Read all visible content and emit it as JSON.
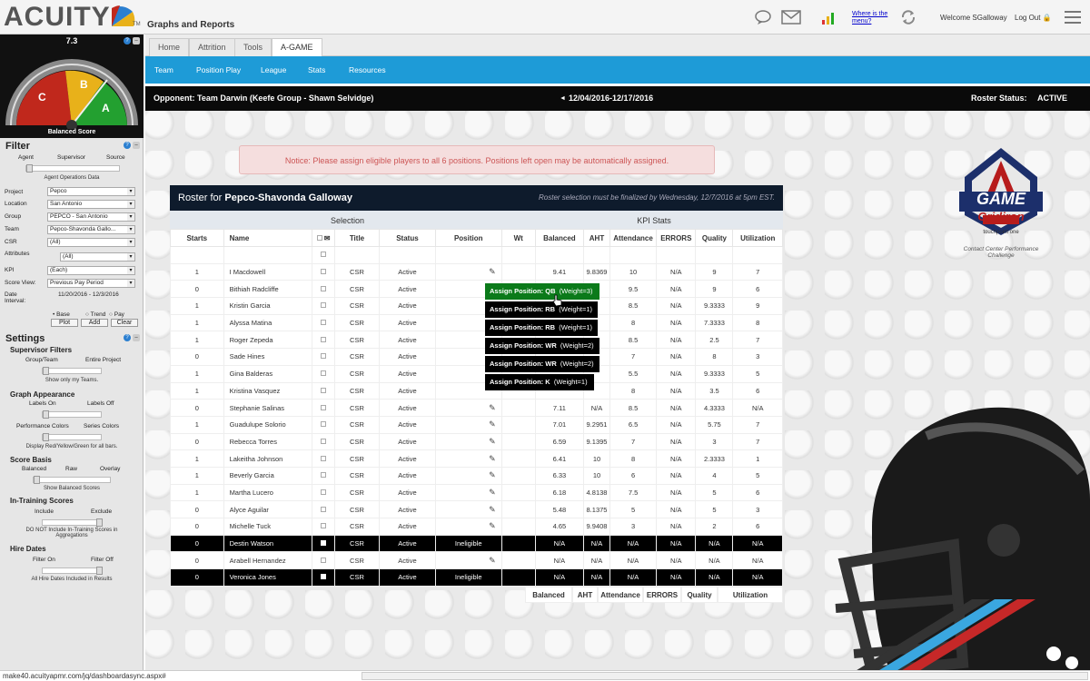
{
  "app": {
    "logo": "ACUITY",
    "logo_tm": "TM",
    "title": "Graphs and Reports",
    "where_link": "Where is the menu?",
    "welcome": "Welcome SGalloway",
    "logout": "Log Out"
  },
  "gauge": {
    "value": "7.3",
    "label": "Balanced Score",
    "zones": [
      "C",
      "B",
      "A"
    ]
  },
  "filter": {
    "title": "Filter",
    "scope_labels": [
      "Agent",
      "Supervisor",
      "Source"
    ],
    "scope_caption": "Agent Operations Data",
    "fields": [
      {
        "label": "Project",
        "value": "Pepco"
      },
      {
        "label": "Location",
        "value": "San Antonio"
      },
      {
        "label": "Group",
        "value": "PEPCO - San Antonio"
      },
      {
        "label": "Team",
        "value": "Pepco-Shavonda Gallo..."
      },
      {
        "label": "CSR",
        "value": "(All)"
      },
      {
        "label": "Attributes",
        "value": "(All)"
      },
      {
        "label": "KPI",
        "value": "(Each)"
      },
      {
        "label": "Score View:",
        "value": "Previous Pay Period"
      }
    ],
    "date_label": "Date Interval:",
    "date_value": "11/20/2016 - 12/3/2016",
    "radios": [
      "Base",
      "Trend",
      "Pay"
    ],
    "buttons": [
      "Plot",
      "Add",
      "Clear"
    ]
  },
  "settings": {
    "title": "Settings",
    "groups": [
      {
        "title": "Supervisor Filters",
        "left": "Group/Team",
        "right": "Entire Project",
        "caption": "Show only my Teams."
      },
      {
        "title": "Graph Appearance",
        "left": "Labels On",
        "right": "Labels Off",
        "caption": ""
      },
      {
        "title": "",
        "left": "Performance Colors",
        "right": "Series Colors",
        "caption": "Display Red/Yellow/Green for all bars."
      },
      {
        "title": "Score Basis",
        "left": "Balanced",
        "mid": "Raw",
        "right": "Overlay",
        "caption": "Show Balanced Scores"
      },
      {
        "title": "In-Training Scores",
        "left": "Include",
        "right": "Exclude",
        "caption": "DO NOT Include In-Training Scores in Aggregations"
      },
      {
        "title": "Hire Dates",
        "left": "Filter On",
        "right": "Filter Off",
        "caption": "All Hire Dates Included in Results"
      }
    ]
  },
  "tabs": [
    "Home",
    "Attrition",
    "Tools",
    "A-GAME"
  ],
  "subnav": [
    "Team",
    "Position Play",
    "League",
    "Stats",
    "Resources"
  ],
  "opponent": {
    "text": "Opponent:  Team Darwin (Keefe Group - Shawn Selvidge)",
    "dates": "12/04/2016-12/17/2016",
    "status_label": "Roster Status:",
    "status_value": "ACTIVE"
  },
  "notice": "Notice: Please assign eligible players to all 6 positions. Positions left open may be automatically assigned.",
  "logo_badge": {
    "line1": "GAME",
    "line2": "Gridiron",
    "brand": "touchpoint one",
    "caption": "Contact Center Performance Challenge"
  },
  "roster": {
    "title_prefix": "Roster for ",
    "title_name": "Pepco-Shavonda Galloway",
    "note": "Roster selection must be finalized by Wednesday, 12/7/2016 at 5pm EST.",
    "group_selection": "Selection",
    "group_kpi": "KPI Stats",
    "columns": [
      "Starts",
      "Name",
      "",
      "Title",
      "Status",
      "Position",
      "Wt",
      "Balanced",
      "AHT",
      "Attendance",
      "ERRORS",
      "Quality",
      "Utilization"
    ],
    "rows": [
      {
        "starts": "1",
        "name": "I Macdowell",
        "title": "CSR",
        "status": "Active",
        "position": "",
        "edit": true,
        "wt": "",
        "balanced": "9.41",
        "aht": "9.8369",
        "attendance": "10",
        "errors": "N/A",
        "quality": "9",
        "utilization": "7",
        "ineligible": false
      },
      {
        "starts": "0",
        "name": "Bithiah Radcliffe",
        "title": "CSR",
        "status": "Active",
        "position": "",
        "edit": false,
        "wt": "",
        "balanced": "",
        "aht": "",
        "attendance": "9.5",
        "errors": "N/A",
        "quality": "9",
        "utilization": "6",
        "ineligible": false
      },
      {
        "starts": "1",
        "name": "Kristin Garcia",
        "title": "CSR",
        "status": "Active",
        "position": "",
        "edit": false,
        "wt": "",
        "balanced": "",
        "aht": "",
        "attendance": "8.5",
        "errors": "N/A",
        "quality": "9.3333",
        "utilization": "9",
        "ineligible": false
      },
      {
        "starts": "1",
        "name": "Alyssa Matina",
        "title": "CSR",
        "status": "Active",
        "position": "",
        "edit": false,
        "wt": "",
        "balanced": "",
        "aht": "",
        "attendance": "8",
        "errors": "N/A",
        "quality": "7.3333",
        "utilization": "8",
        "ineligible": false
      },
      {
        "starts": "1",
        "name": "Roger Zepeda",
        "title": "CSR",
        "status": "Active",
        "position": "",
        "edit": false,
        "wt": "",
        "balanced": "",
        "aht": "",
        "attendance": "8.5",
        "errors": "N/A",
        "quality": "2.5",
        "utilization": "7",
        "ineligible": false
      },
      {
        "starts": "0",
        "name": "Sade Hines",
        "title": "CSR",
        "status": "Active",
        "position": "",
        "edit": false,
        "wt": "",
        "balanced": "",
        "aht": "",
        "attendance": "7",
        "errors": "N/A",
        "quality": "8",
        "utilization": "3",
        "ineligible": false
      },
      {
        "starts": "1",
        "name": "Gina Balderas",
        "title": "CSR",
        "status": "Active",
        "position": "",
        "edit": false,
        "wt": "",
        "balanced": "",
        "aht": "",
        "attendance": "5.5",
        "errors": "N/A",
        "quality": "9.3333",
        "utilization": "5",
        "ineligible": false
      },
      {
        "starts": "1",
        "name": "Kristina Vasquez",
        "title": "CSR",
        "status": "Active",
        "position": "",
        "edit": false,
        "wt": "",
        "balanced": "",
        "aht": "",
        "attendance": "8",
        "errors": "N/A",
        "quality": "3.5",
        "utilization": "6",
        "ineligible": false
      },
      {
        "starts": "0",
        "name": "Stephanie Salinas",
        "title": "CSR",
        "status": "Active",
        "position": "",
        "edit": true,
        "wt": "",
        "balanced": "7.11",
        "aht": "N/A",
        "attendance": "8.5",
        "errors": "N/A",
        "quality": "4.3333",
        "utilization": "N/A",
        "ineligible": false
      },
      {
        "starts": "1",
        "name": "Guadulupe Solorio",
        "title": "CSR",
        "status": "Active",
        "position": "",
        "edit": true,
        "wt": "",
        "balanced": "7.01",
        "aht": "9.2951",
        "attendance": "6.5",
        "errors": "N/A",
        "quality": "5.75",
        "utilization": "7",
        "ineligible": false
      },
      {
        "starts": "0",
        "name": "Rebecca Torres",
        "title": "CSR",
        "status": "Active",
        "position": "",
        "edit": true,
        "wt": "",
        "balanced": "6.59",
        "aht": "9.1395",
        "attendance": "7",
        "errors": "N/A",
        "quality": "3",
        "utilization": "7",
        "ineligible": false
      },
      {
        "starts": "1",
        "name": "Lakeitha Johnson",
        "title": "CSR",
        "status": "Active",
        "position": "",
        "edit": true,
        "wt": "",
        "balanced": "6.41",
        "aht": "10",
        "attendance": "8",
        "errors": "N/A",
        "quality": "2.3333",
        "utilization": "1",
        "ineligible": false
      },
      {
        "starts": "1",
        "name": "Beverly Garcia",
        "title": "CSR",
        "status": "Active",
        "position": "",
        "edit": true,
        "wt": "",
        "balanced": "6.33",
        "aht": "10",
        "attendance": "6",
        "errors": "N/A",
        "quality": "4",
        "utilization": "5",
        "ineligible": false
      },
      {
        "starts": "1",
        "name": "Martha Lucero",
        "title": "CSR",
        "status": "Active",
        "position": "",
        "edit": true,
        "wt": "",
        "balanced": "6.18",
        "aht": "4.8138",
        "attendance": "7.5",
        "errors": "N/A",
        "quality": "5",
        "utilization": "6",
        "ineligible": false
      },
      {
        "starts": "0",
        "name": "Alyce Aguilar",
        "title": "CSR",
        "status": "Active",
        "position": "",
        "edit": true,
        "wt": "",
        "balanced": "5.48",
        "aht": "8.1375",
        "attendance": "5",
        "errors": "N/A",
        "quality": "5",
        "utilization": "3",
        "ineligible": false
      },
      {
        "starts": "0",
        "name": "Michelle Tuck",
        "title": "CSR",
        "status": "Active",
        "position": "",
        "edit": true,
        "wt": "",
        "balanced": "4.65",
        "aht": "9.9408",
        "attendance": "3",
        "errors": "N/A",
        "quality": "2",
        "utilization": "6",
        "ineligible": false
      },
      {
        "starts": "0",
        "name": "Destin Watson",
        "title": "CSR",
        "status": "Active",
        "position": "Ineligible",
        "edit": false,
        "wt": "",
        "balanced": "N/A",
        "aht": "N/A",
        "attendance": "N/A",
        "errors": "N/A",
        "quality": "N/A",
        "utilization": "N/A",
        "ineligible": true
      },
      {
        "starts": "0",
        "name": "Arabell Hernandez",
        "title": "CSR",
        "status": "Active",
        "position": "",
        "edit": true,
        "wt": "",
        "balanced": "N/A",
        "aht": "N/A",
        "attendance": "N/A",
        "errors": "N/A",
        "quality": "N/A",
        "utilization": "N/A",
        "ineligible": false
      },
      {
        "starts": "0",
        "name": "Veronica Jones",
        "title": "CSR",
        "status": "Active",
        "position": "Ineligible",
        "edit": false,
        "wt": "",
        "balanced": "N/A",
        "aht": "N/A",
        "attendance": "N/A",
        "errors": "N/A",
        "quality": "N/A",
        "utilization": "N/A",
        "ineligible": true
      }
    ],
    "footer": [
      "Balanced",
      "AHT",
      "Attendance",
      "ERRORS",
      "Quality",
      "Utilization"
    ]
  },
  "assign_popup": [
    {
      "label": "Assign Position: QB",
      "weight": "(Weight=3)"
    },
    {
      "label": "Assign Position: RB",
      "weight": "(Weight=1)"
    },
    {
      "label": "Assign Position: RB",
      "weight": "(Weight=1)"
    },
    {
      "label": "Assign Position: WR",
      "weight": "(Weight=2)"
    },
    {
      "label": "Assign Position: WR",
      "weight": "(Weight=2)"
    },
    {
      "label": "Assign Position: K",
      "weight": "(Weight=1)"
    }
  ],
  "statusbar": "make40.acuityapmr.com/jq/dashboardasync.aspx#",
  "colors": {
    "accent_blue": "#1e9bd7",
    "header_dark": "#0e1b2c",
    "assign_green": "#0b7a1a",
    "zone_c": "#c0281c",
    "zone_b": "#e8b11a",
    "zone_a": "#23a030"
  }
}
